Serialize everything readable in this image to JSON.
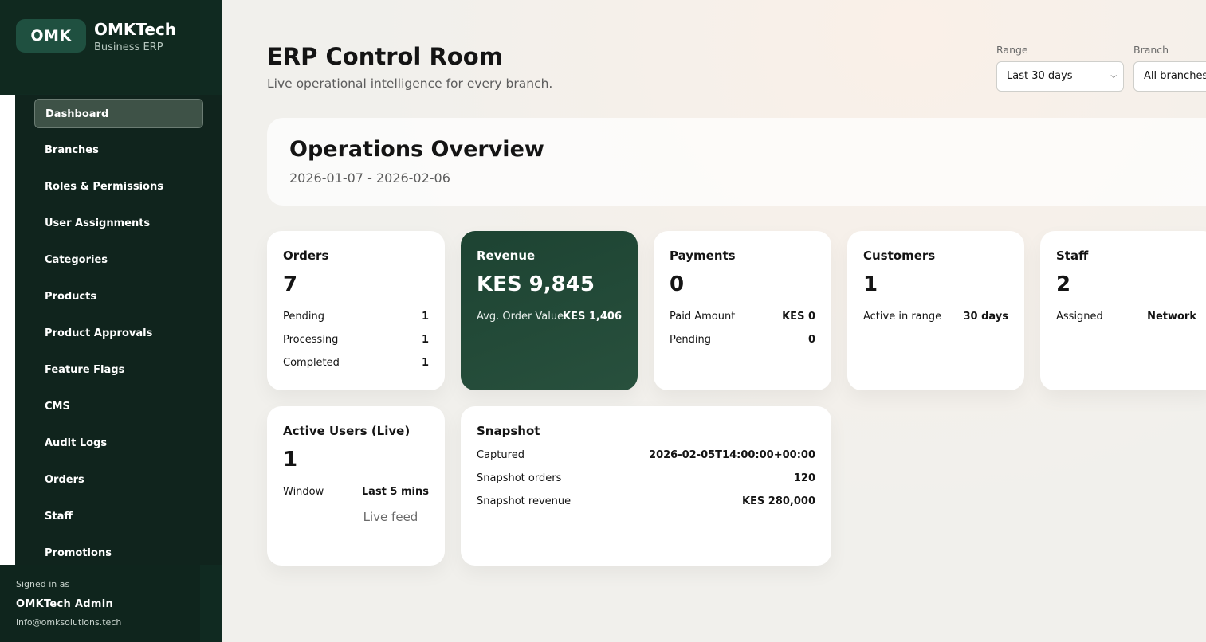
{
  "sidebar": {
    "logo": "OMK",
    "brand_name": "OMKTech",
    "brand_sub": "Business ERP",
    "items": [
      {
        "label": "Dashboard",
        "active": true
      },
      {
        "label": "Branches"
      },
      {
        "label": "Roles & Permissions"
      },
      {
        "label": "User Assignments"
      },
      {
        "label": "Categories"
      },
      {
        "label": "Products"
      },
      {
        "label": "Product Approvals"
      },
      {
        "label": "Feature Flags"
      },
      {
        "label": "CMS"
      },
      {
        "label": "Audit Logs"
      },
      {
        "label": "Orders"
      },
      {
        "label": "Staff"
      },
      {
        "label": "Promotions"
      }
    ],
    "signed_in_label": "Signed in as",
    "user_name": "OMKTech Admin",
    "user_email": "info@omksolutions.tech"
  },
  "header": {
    "title": "ERP Control Room",
    "subtitle": "Live operational intelligence for every branch.",
    "range_label": "Range",
    "range_value": "Last 30 days",
    "branch_label": "Branch",
    "branch_value": "All branches"
  },
  "overview": {
    "title": "Operations Overview",
    "date_range": "2026-01-07 - 2026-02-06"
  },
  "cards": {
    "orders": {
      "title": "Orders",
      "value": "7",
      "rows": [
        {
          "label": "Pending",
          "value": "1"
        },
        {
          "label": "Processing",
          "value": "1"
        },
        {
          "label": "Completed",
          "value": "1"
        }
      ]
    },
    "revenue": {
      "title": "Revenue",
      "value": "KES 9,845",
      "rows": [
        {
          "label": "Avg. Order Value",
          "value": "KES 1,406"
        }
      ]
    },
    "payments": {
      "title": "Payments",
      "value": "0",
      "rows": [
        {
          "label": "Paid Amount",
          "value": "KES 0"
        },
        {
          "label": "Pending",
          "value": "0"
        }
      ]
    },
    "customers": {
      "title": "Customers",
      "value": "1",
      "rows": [
        {
          "label": "Active in range",
          "value": "30 days"
        }
      ]
    },
    "staff": {
      "title": "Staff",
      "value": "2",
      "rows": [
        {
          "label": "Assigned",
          "value": "Network"
        }
      ]
    },
    "active_users": {
      "title": "Active Users (Live)",
      "value": "1",
      "rows": [
        {
          "label": "Window",
          "value": "Last 5 mins"
        }
      ],
      "live_feed": "Live feed"
    },
    "snapshot": {
      "title": "Snapshot",
      "rows": [
        {
          "label": "Captured",
          "value": "2026-02-05T14:00:00+00:00"
        },
        {
          "label": "Snapshot orders",
          "value": "120"
        },
        {
          "label": "Snapshot revenue",
          "value": "KES 280,000"
        }
      ]
    }
  },
  "colors": {
    "sidebar_bg": "#102a21",
    "logo_bg": "#1f5040",
    "revenue_card_bg": "#24493a",
    "page_bg": "#f1f0ec"
  }
}
